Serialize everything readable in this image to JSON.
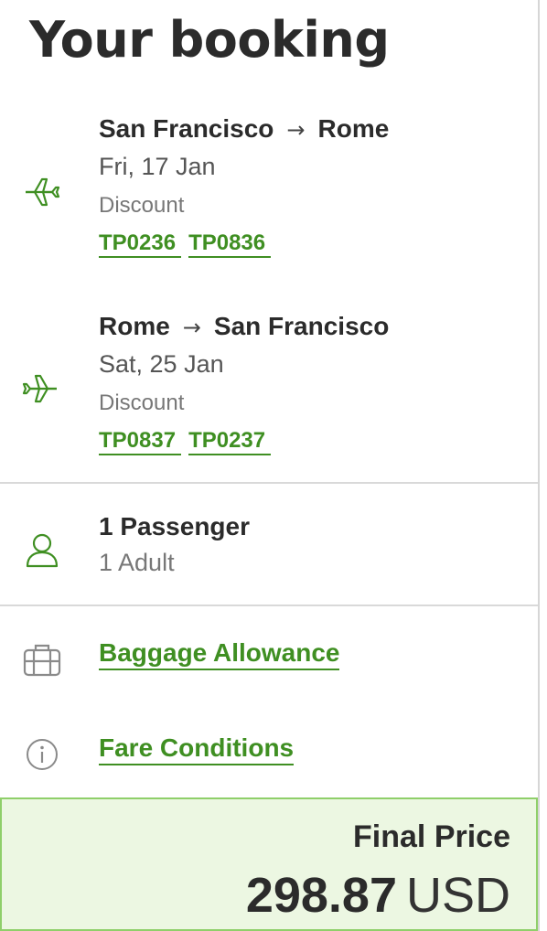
{
  "page_title": "Your booking",
  "colors": {
    "accent": "#3f8f22",
    "price_bg": "#ecf7e2",
    "price_border": "#8fcf6a"
  },
  "outbound": {
    "origin": "San Francisco",
    "destination": "Rome",
    "date": "Fri, 17 Jan",
    "fare": "Discount",
    "flights": [
      "TP0236",
      "TP0836"
    ],
    "icon": "plane-departure-icon"
  },
  "inbound": {
    "origin": "Rome",
    "destination": "San Francisco",
    "date": "Sat, 25 Jan",
    "fare": "Discount",
    "flights": [
      "TP0837",
      "TP0237"
    ],
    "icon": "plane-return-icon"
  },
  "passengers": {
    "title": "1 Passenger",
    "detail": "1 Adult",
    "icon": "user-icon"
  },
  "links": {
    "baggage": "Baggage Allowance",
    "fare_conditions": "Fare Conditions"
  },
  "price": {
    "label": "Final Price",
    "amount": "298.87",
    "currency": "USD"
  }
}
